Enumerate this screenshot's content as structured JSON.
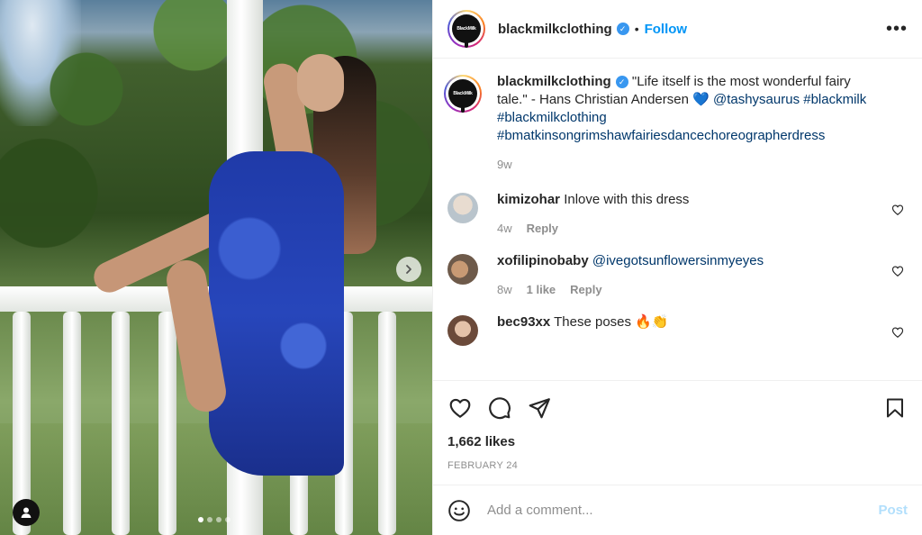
{
  "post": {
    "account": "blackmilkclothing",
    "avatar_logo": "BlackMilk",
    "follow_label": "Follow",
    "separator": "•",
    "more_label": "•••"
  },
  "caption": {
    "username": "blackmilkclothing",
    "quote": "\"Life itself is the most wonderful fairy tale.\" - Hans Christian Andersen",
    "heart_emoji": "💙",
    "mention": "@tashysaurus",
    "hashtag1": "#blackmilk",
    "hashtag2": "#blackmilkclothing",
    "hashtag3": "#bmatkinsongrimshawfairiesdancechoreographerdress",
    "age": "9w"
  },
  "comments": [
    {
      "username": "kimizohar",
      "text": "Inlove with this dress",
      "age": "4w",
      "likes": "",
      "reply_label": "Reply"
    },
    {
      "username": "xofilipinobaby",
      "text": "@ivegotsunflowersinmyeyes",
      "age": "8w",
      "likes": "1 like",
      "reply_label": "Reply"
    },
    {
      "username": "bec93xx",
      "text": "These poses 🔥👏",
      "age": "",
      "likes": "",
      "reply_label": ""
    }
  ],
  "engagement": {
    "likes": "1,662 likes",
    "date": "FEBRUARY 24"
  },
  "composer": {
    "placeholder": "Add a comment...",
    "post_label": "Post"
  },
  "carousel": {
    "count": 4,
    "active": 0
  },
  "colors": {
    "accent_blue": "#0095f6",
    "link_dark_blue": "#00376b",
    "muted": "#8e8e8e",
    "post_disabled": "#b2dffc",
    "verified": "#3897f0"
  },
  "icons": {
    "like": "heart-icon",
    "comment": "comment-icon",
    "share": "paper-plane-icon",
    "save": "bookmark-icon",
    "emoji": "smiley-icon",
    "next": "chevron-right-icon",
    "tagged": "user-icon"
  }
}
